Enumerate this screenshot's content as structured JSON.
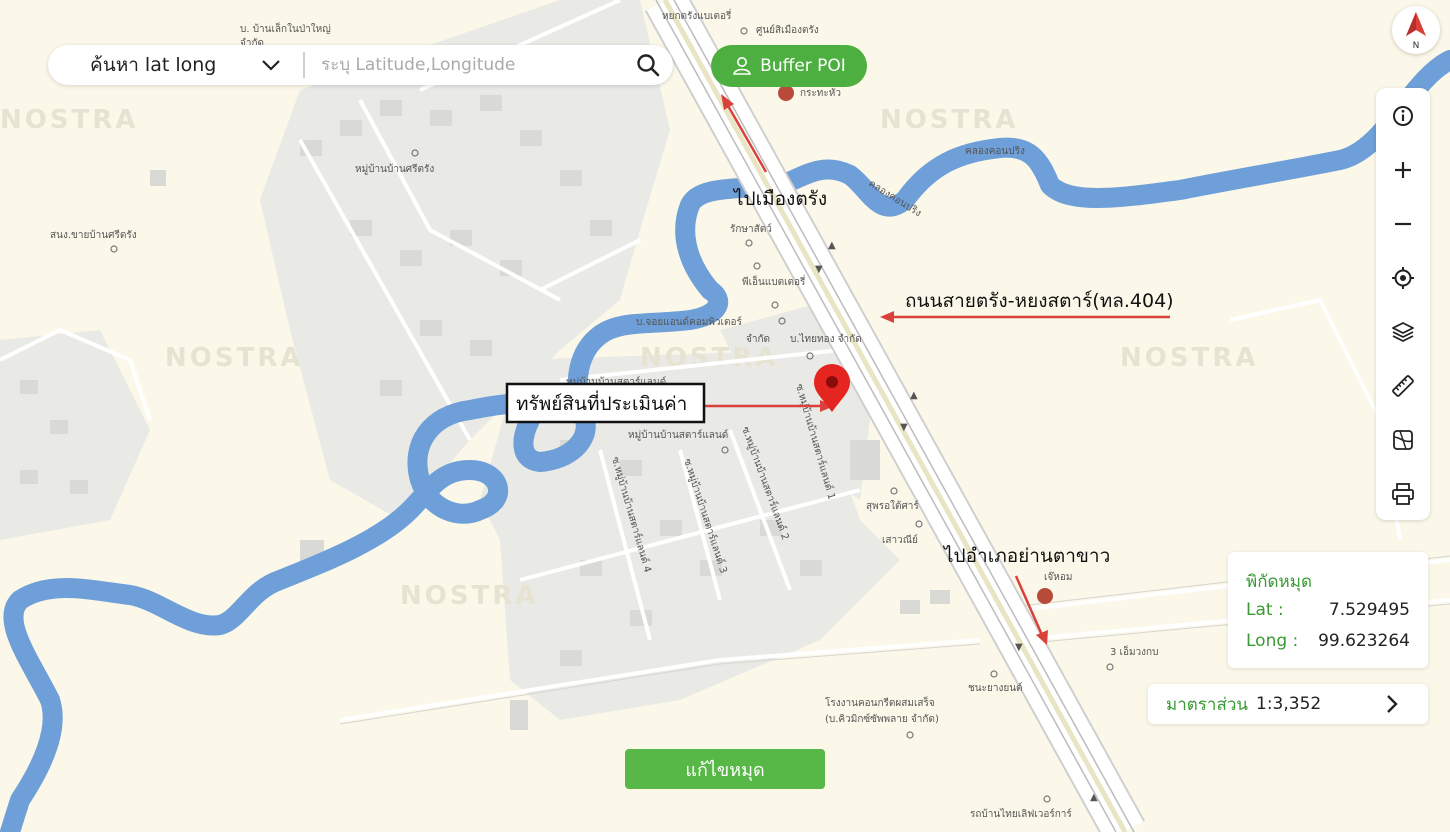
{
  "search": {
    "type_label": "ค้นหา lat long",
    "placeholder": "ระบุ Latitude,Longitude"
  },
  "buffer_button": {
    "label": "Buffer POI"
  },
  "compass": {
    "label": "N"
  },
  "coordinates": {
    "title": "พิกัดหมุด",
    "lat_label": "Lat :",
    "lat_value": "7.529495",
    "long_label": "Long :",
    "long_value": "99.623264"
  },
  "scale": {
    "label": "มาตราส่วน",
    "value": "1:3,352"
  },
  "edit_pin_button": {
    "label": "แก้ไขหมุด"
  },
  "annotations": {
    "to_trang": "ไปเมืองตรัง",
    "road": "ถนนสายตรัง-หยงสตาร์(ทล.404)",
    "property": "ทรัพย์สินที่ประเมินค่า",
    "to_yan_ta_khao": "ไปอำเภอย่านตาขาว"
  },
  "map_labels": {
    "poi_1": "บ. บ้านเล็กในป่าใหญ่",
    "poi_2": "จำกัด",
    "poi_3": "หยกตรังแบเตอรี่",
    "poi_4": "ศูนย์สิเมืองตรัง",
    "poi_5": "กระทะหัว",
    "poi_6": "หมู่บ้านบ้านศรีตรัง",
    "poi_7": "สนง.ขายบ้านศรีตรัง",
    "poi_8": "รักษาสัตว์",
    "poi_9": "พีเอ็นแบตเตอรี่",
    "poi_10": "บ.จอยแอนด์คอมพิวเตอร์",
    "poi_11": "จำกัด",
    "poi_12": "บ.ไทยทอง จำกัด",
    "poi_13": "หมู่บ้านบ้านสตาร์แลนด์",
    "poi_14": "สุพรอใต้ศาร์",
    "poi_15": "เสาวณีย์",
    "poi_16": "เจ๊หอม",
    "poi_17": "3 เอ็มวงกบ",
    "poi_18": "ชนะยางยนต์",
    "poi_19": "โรงงานคอนกรีตผสมเสร็จ",
    "poi_20": "(บ.คิวมิกซ์ซัพพลาย จำกัด)",
    "poi_21": "รถบ้านไทยเลิฟเวอร์การ์",
    "canal_1": "คลองคอนปริง",
    "canal_2": "คลองคอนปริง",
    "watermark": "NOSTRA",
    "street_1": "ซ.หมู่บ้านบ้านสตาร์แลนด์ 1",
    "street_2": "ซ.หมู่บ้านบ้านสตาร์แลนด์ 2",
    "street_3": "ซ.หมู่บ้านบ้านสตาร์แลนด์ 3",
    "street_4": "ซ.หมู่บ้านบ้านสตาร์แลนด์ 4",
    "street_5": "หมู่บ้านบ้านสตาร์แลนด์"
  },
  "colors": {
    "map_background": "#fbf8e9",
    "river": "#6e9fd8",
    "accent_green": "#4caf3f",
    "annotation_arrow": "#d9413a",
    "pin": "#e52520"
  }
}
